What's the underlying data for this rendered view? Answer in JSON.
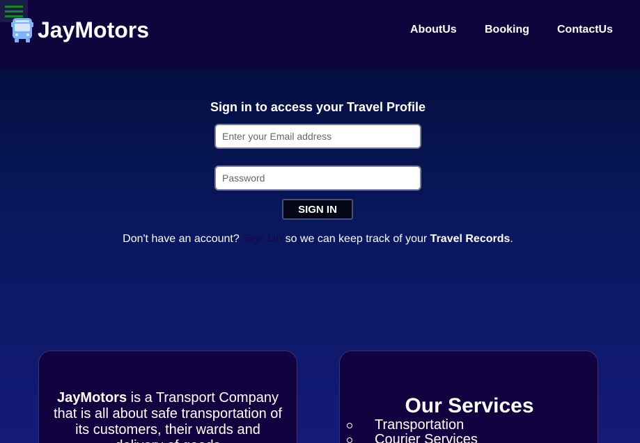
{
  "header": {
    "brand": "JayMotors",
    "nav": [
      "AboutUs",
      "Booking",
      "ContactUs"
    ]
  },
  "signin": {
    "title": "Sign in to access your Travel Profile",
    "email_placeholder": "Enter your Email address",
    "password_placeholder": "Password",
    "button_label": "SIGN IN",
    "prompt_before": "Don't have an account? ",
    "signup_link": "Sign Up",
    "prompt_middle": " so we can keep track of your ",
    "prompt_bold": "Travel Records",
    "prompt_end": "."
  },
  "about": {
    "brand": "JayMotors",
    "text": " is a Transport Company that is all about safe transportation of its customers, their wards and delivery of goods"
  },
  "services": {
    "title": "Our Services",
    "items": [
      "Transportation",
      "Courier Services"
    ]
  },
  "colors": {
    "header_bg": "#10043d",
    "card_bg": "#110340",
    "menu_icon": "#138a21",
    "bus_icon": "#7fb2ff"
  },
  "icons": {
    "menu": "hamburger-menu-icon",
    "logo": "bus-icon"
  }
}
